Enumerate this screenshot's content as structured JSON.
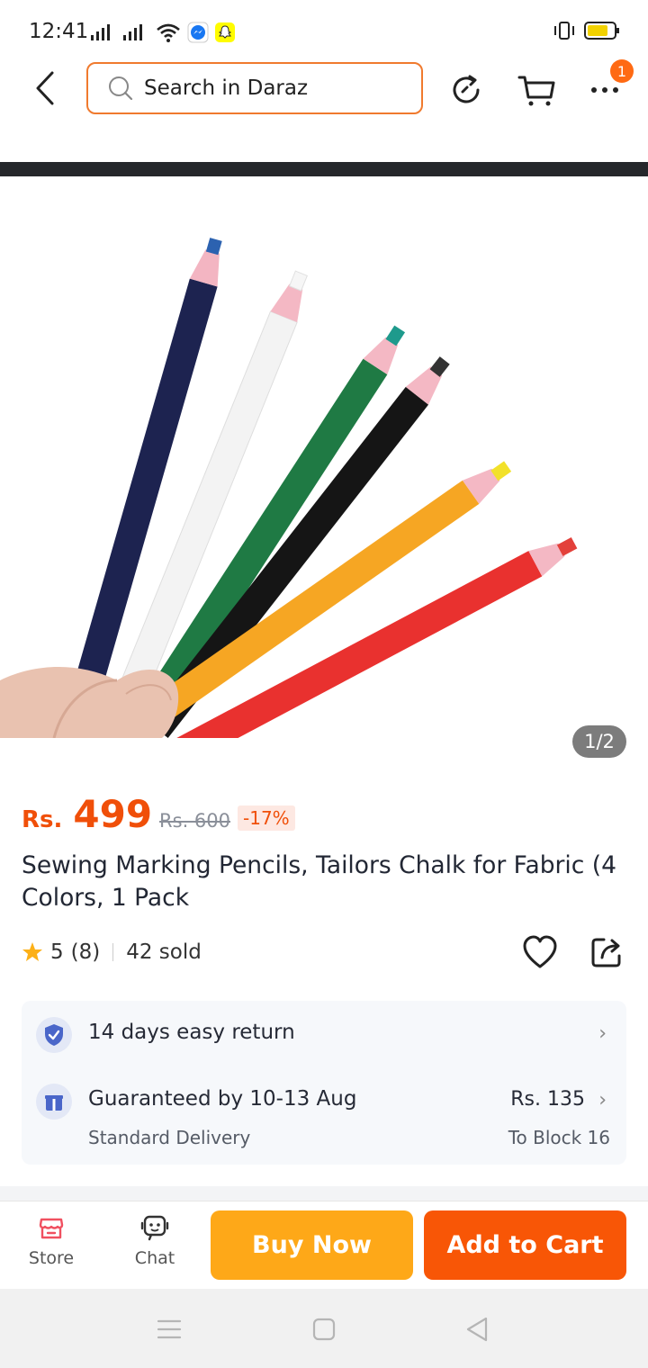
{
  "status_bar": {
    "time": "12:41"
  },
  "header": {
    "search_placeholder": "Search in Daraz",
    "more_badge": "1"
  },
  "image": {
    "counter": "1/2"
  },
  "product": {
    "currency": "Rs.",
    "price": "499",
    "old_price": "Rs. 600",
    "discount": "-17%",
    "title": "Sewing Marking Pencils, Tailors Chalk for Fabric (4 Colors, 1 Pack",
    "rating": "5",
    "rating_count": "(8)",
    "sold": "42 sold"
  },
  "services": {
    "return": {
      "label": "14 days easy return"
    },
    "delivery": {
      "label": "Guaranteed by 10-13 Aug",
      "type": "Standard Delivery",
      "price": "Rs. 135",
      "destination": "To Block 16"
    }
  },
  "bottom_bar": {
    "store_label": "Store",
    "chat_label": "Chat",
    "buy_now_label": "Buy Now",
    "add_to_cart_label": "Add to Cart"
  },
  "colors": {
    "accent_orange": "#f85606",
    "buy_now_yellow": "#fea818",
    "price_orange": "#f04f09"
  }
}
